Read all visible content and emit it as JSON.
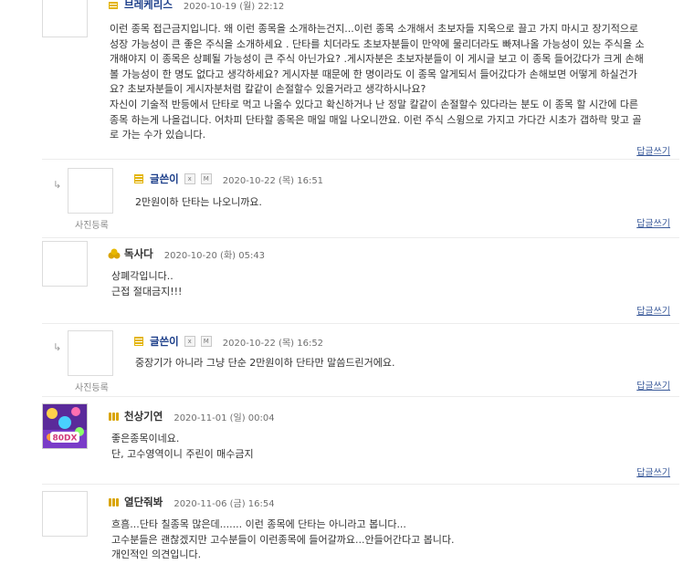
{
  "comments": [
    {
      "nick": "브레케리스",
      "date": "2020-10-19 (월) 22:12",
      "lines": [
        "이런 종목 접근금지입니다. 왜 이런 종목을 소개하는건지...이런 종목 소개해서 초보자들 지옥으로 끌고 가지 마시고 장기적으로",
        "성장 가능성이 큰 좋은 주식을 소개하세요 . 단타를 치더라도 초보자분들이 만약에 물리더라도 빠져나올 가능성이 있는 주식을 소",
        "개해야지 이 종목은 상폐될 가능성이 큰 주식 아닌가요? .게시자분은 초보자분들이 이 게시글 보고 이 종목 들어갔다가 크게 손해",
        "볼 가능성이 한 명도  없다고 생각하세요? 게시자분 때문에 한 명이라도 이 종목 알게되서 들어갔다가 손해보면 어떻게 하실건가",
        "요? 초보자분들이 게시자분처럼 칼같이 손절할수 있을거라고 생각하시나요?",
        "자신이 기술적 반등에서 단타로 먹고 나올수 있다고 확신하거나 난 정말 칼같이 손절할수 있다라는 분도 이 종목 할 시간에 다른",
        "종목 하는게 나을겁니다. 어차피 단타할 종목은 매일 매일 나오니깐요.  이런 주식 스윙으로 가지고 가다간 시초가 갭하락 맞고 골",
        "로 가는 수가 있습니다."
      ],
      "reply_link": "답글쓰기"
    },
    {
      "nick": "글쓴이",
      "date": "2020-10-22 (목) 16:51",
      "lines": [
        "2만원이하 단타는 나오니까요."
      ],
      "reply_link": "답글쓰기",
      "photo_label": "사진등록",
      "arrow": "↳"
    },
    {
      "nick": "독사다",
      "date": "2020-10-20 (화) 05:43",
      "lines": [
        "상폐각입니다..",
        "근접 절대금지!!!"
      ],
      "reply_link": "답글쓰기"
    },
    {
      "nick": "글쓴이",
      "date": "2020-10-22 (목) 16:52",
      "lines": [
        "중장기가 아니라 그냥 단순 2만원이하 단타만 말씀드린거에요."
      ],
      "reply_link": "답글쓰기",
      "photo_label": "사진등록",
      "arrow": "↳"
    },
    {
      "nick": "천상기연",
      "date": "2020-11-01 (일) 00:04",
      "lines": [
        "좋은종목이네요.",
        "단, 고수영역이니 주린이 매수금지"
      ],
      "reply_link": "답글쓰기",
      "avatar_text": "80DX"
    },
    {
      "nick": "열단줘봐",
      "date": "2020-11-06 (금) 16:54",
      "lines": [
        "흐흠...단타 칠종목 많은데....... 이런 종목에 단타는 아니라고 봅니다...",
        "고수분들은 괜찮겠지만 고수분들이 이런종목에 들어갈까요...안들어간다고 봅니다.",
        "개인적인 의견입니다."
      ]
    }
  ],
  "mini_buttons": {
    "x": "x",
    "m": "M"
  },
  "colors": {
    "nick": "#1d3f8a",
    "date": "#6e6e6e",
    "link": "#3a5a9a",
    "grade_gold": "#d9a400",
    "grade_block": "#e3b400"
  }
}
